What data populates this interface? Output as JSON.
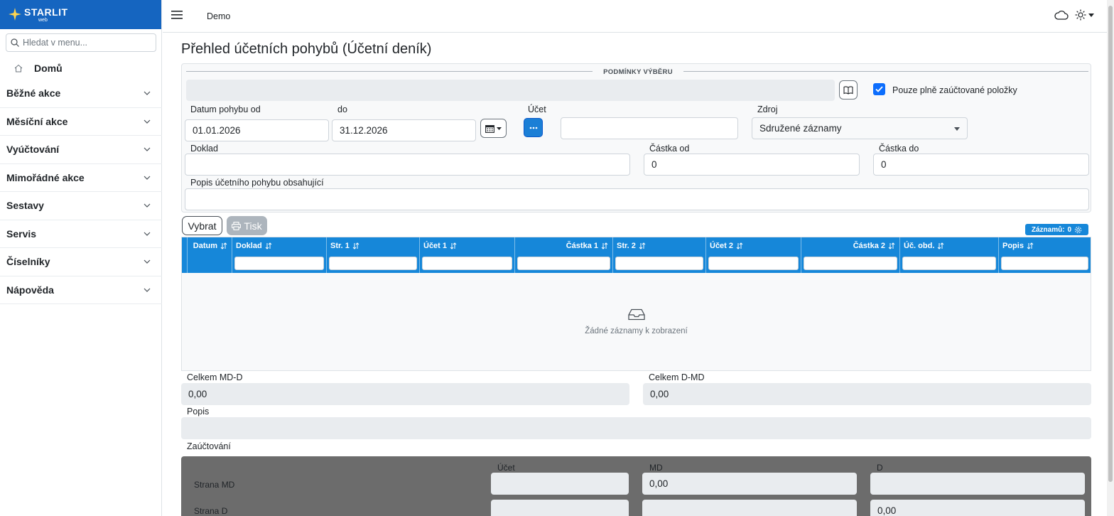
{
  "brand": {
    "name": "STARLIT",
    "sub": "web"
  },
  "sidebar": {
    "search_placeholder": "Hledat v menu...",
    "home_label": "Domů",
    "items": [
      {
        "label": "Běžné akce"
      },
      {
        "label": "Měsíční akce"
      },
      {
        "label": "Vyúčtování"
      },
      {
        "label": "Mimořádné akce"
      },
      {
        "label": "Sestavy"
      },
      {
        "label": "Servis"
      },
      {
        "label": "Číselníky"
      },
      {
        "label": "Nápověda"
      }
    ]
  },
  "topbar": {
    "title": "Demo"
  },
  "page": {
    "title": "Přehled účetních pohybů (Účetní deník)"
  },
  "filter": {
    "legend": "PODMÍNKY VÝBĚRU",
    "checkbox_label": "Pouze plně zaúčtované položky",
    "checkbox_checked": true,
    "date_from_label": "Datum pohybu od",
    "date_from": "01.01.2026",
    "date_to_label": "do",
    "date_to": "31.12.2026",
    "account_label": "Účet",
    "account_value": "",
    "source_label": "Zdroj",
    "source_value": "Sdružené záznamy",
    "doc_label": "Doklad",
    "amount_from_label": "Částka od",
    "amount_from": "0",
    "amount_to_label": "Částka do",
    "amount_to": "0",
    "desc_label": "Popis účetního pohybu obsahující"
  },
  "toolbar": {
    "select_label": "Vybrat",
    "print_label": "Tisk",
    "records_label": "Záznamů:",
    "records_count": "0"
  },
  "table": {
    "columns": [
      {
        "label": "Datum"
      },
      {
        "label": "Doklad"
      },
      {
        "label": "Str. 1"
      },
      {
        "label": "Účet 1"
      },
      {
        "label": "Částka 1"
      },
      {
        "label": "Str. 2"
      },
      {
        "label": "Účet 2"
      },
      {
        "label": "Částka 2"
      },
      {
        "label": "Úč. obd."
      },
      {
        "label": "Popis"
      }
    ],
    "empty_text": "Žádné záznamy k zobrazení"
  },
  "totals": {
    "md_d_label": "Celkem MD-D",
    "md_d_value": "0,00",
    "d_md_label": "Celkem D-MD",
    "d_md_value": "0,00",
    "desc_label": "Popis"
  },
  "posting": {
    "section_label": "Zaúčtování",
    "col_account": "Účet",
    "col_md": "MD",
    "col_d": "D",
    "row_md_label": "Strana MD",
    "row_md_md": "0,00",
    "row_d_label": "Strana D",
    "row_d_d": "0,00"
  },
  "colors": {
    "brand": "#1565c0",
    "table_header": "#1687d9",
    "checkbox": "#0d6efd",
    "posting_bg": "#6c6c6c"
  }
}
